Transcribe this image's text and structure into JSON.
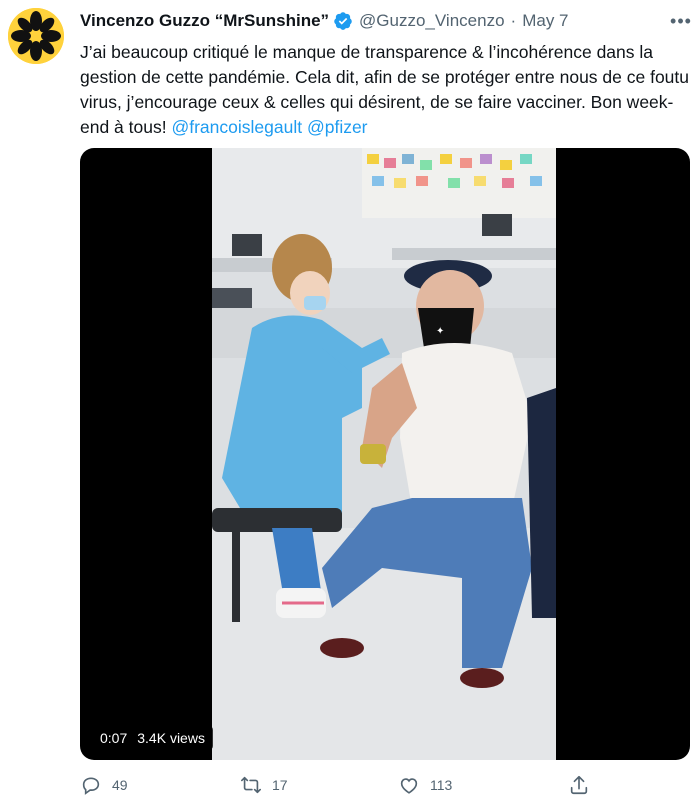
{
  "author": {
    "name": "Vincenzo Guzzo “MrSunshine”",
    "handle": "@Guzzo_Vincenzo",
    "separator": "·",
    "date": "May 7",
    "avatar_icon": "flower-logo-icon",
    "verified_icon": "verified-badge-icon"
  },
  "tweet": {
    "text": "J’ai beaucoup critiqué le manque de transparence & l’incohérence dans la gestion de cette pandémie. Cela dit, afin de se protéger entre nous de ce foutu virus, j’encourage ceux & celles qui désirent, de se faire vacciner. Bon week-end à tous! ",
    "mention_1": "@francoislegault",
    "mention_2": "@pfizer"
  },
  "video": {
    "duration": "0:07",
    "views": "3.4K views",
    "description": "vaccination-scene"
  },
  "actions": {
    "reply_count": "49",
    "retweet_count": "17",
    "like_count": "113"
  },
  "colors": {
    "accent": "#1d9bf0",
    "secondary_text": "#536471",
    "avatar_bg": "#ffd23c"
  }
}
